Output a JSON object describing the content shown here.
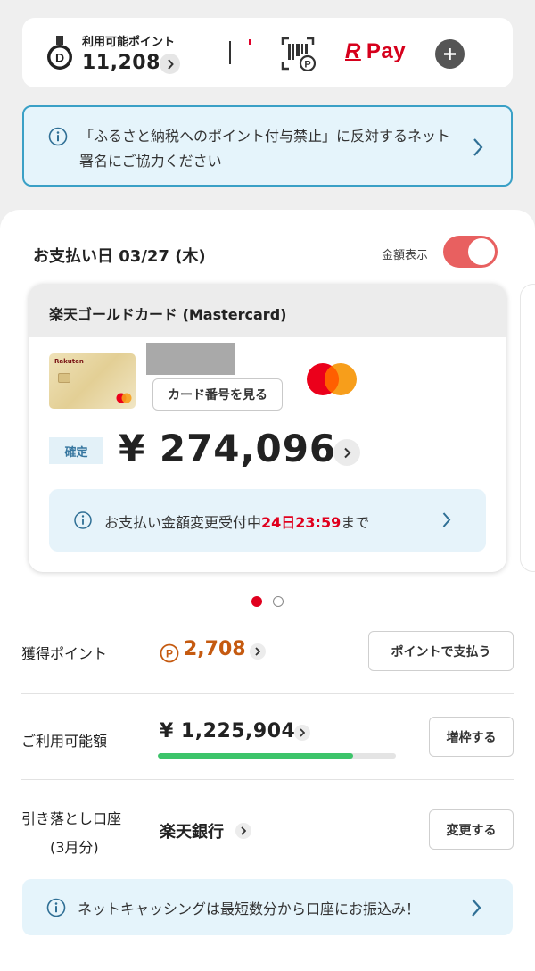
{
  "points": {
    "label": "利用可能ポイント",
    "value": "11,208",
    "medal_letter": "D",
    "rpay_r": "R",
    "rpay_text": "Pay"
  },
  "banner_top": {
    "text": "「ふるさと納税へのポイント付与禁止」に反対するネット署名にご協力ください"
  },
  "payment": {
    "date_label": "お支払い日 03/27 (木)",
    "amount_toggle_label": "金額表示",
    "amount_toggle_on": true
  },
  "card": {
    "title": "楽天ゴールドカード (Mastercard)",
    "brand_mini": "Rakuten",
    "view_number_button": "カード番号を見る",
    "status": "確定",
    "amount": "¥ 274,096",
    "change_text_prefix": "お支払い金額変更受付中",
    "change_deadline": "24日23:59",
    "change_text_suffix": "まで"
  },
  "carousel": {
    "total": 2,
    "active": 1
  },
  "rows": {
    "points_label": "獲得ポイント",
    "points_value": "2,708",
    "points_icon_letter": "P",
    "points_button": "ポイントで支払う",
    "limit_label": "ご利用可能額",
    "limit_value": "¥ 1,225,904",
    "limit_usage_fraction": 0.82,
    "limit_button": "増枠する",
    "account_label_line1": "引き落とし口座",
    "account_label_line2": "(3月分)",
    "account_value": "楽天銀行",
    "account_button": "変更する"
  },
  "banner_bottom": {
    "text": "ネットキャッシングは最短数分から口座にお振込み！"
  },
  "colors": {
    "brand_red": "#e0001e",
    "info_blue": "#3aa0c6",
    "points_orange": "#c55a10",
    "progress_green": "#3cc46a",
    "toggle_red": "#e86060"
  }
}
